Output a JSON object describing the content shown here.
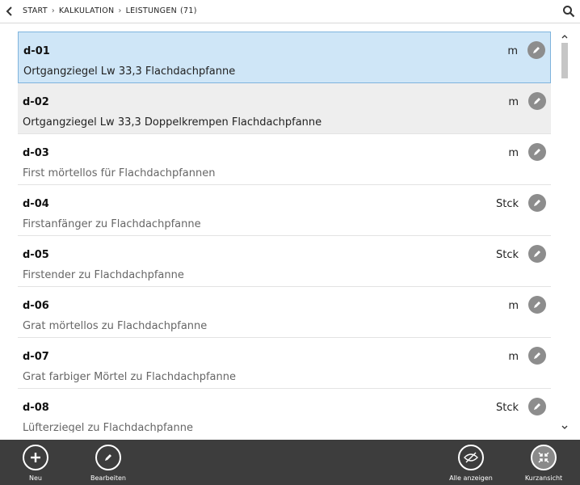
{
  "header": {
    "breadcrumb": [
      "START",
      "KALKULATION",
      "LEISTUNGEN"
    ],
    "count": "(71)",
    "separator": "›"
  },
  "items": [
    {
      "code": "d-01",
      "unit": "m",
      "desc": "Ortgangziegel Lw 33,3 Flachdachpfanne"
    },
    {
      "code": "d-02",
      "unit": "m",
      "desc": "Ortgangziegel Lw 33,3 Doppelkrempen Flachdachpfanne"
    },
    {
      "code": "d-03",
      "unit": "m",
      "desc": "First mörtellos für Flachdachpfannen"
    },
    {
      "code": "d-04",
      "unit": "Stck",
      "desc": "Firstanfänger zu Flachdachpfanne"
    },
    {
      "code": "d-05",
      "unit": "Stck",
      "desc": "Firstender zu Flachdachpfanne"
    },
    {
      "code": "d-06",
      "unit": "m",
      "desc": "Grat mörtellos zu Flachdachpfanne"
    },
    {
      "code": "d-07",
      "unit": "m",
      "desc": "Grat farbiger Mörtel zu Flachdachpfanne"
    },
    {
      "code": "d-08",
      "unit": "Stck",
      "desc": "Lüfterziegel zu Flachdachpfanne"
    }
  ],
  "selected_index": 0,
  "colors": {
    "selected_bg": "#cfe6f7",
    "alt_bg": "#eeeeee",
    "bottombar_bg": "#3d3d3d",
    "icon_grey": "#8d8d8d"
  },
  "bottombar": {
    "new_label": "Neu",
    "edit_label": "Bearbeiten",
    "show_all_label": "Alle anzeigen",
    "compact_label": "Kurzansicht"
  }
}
